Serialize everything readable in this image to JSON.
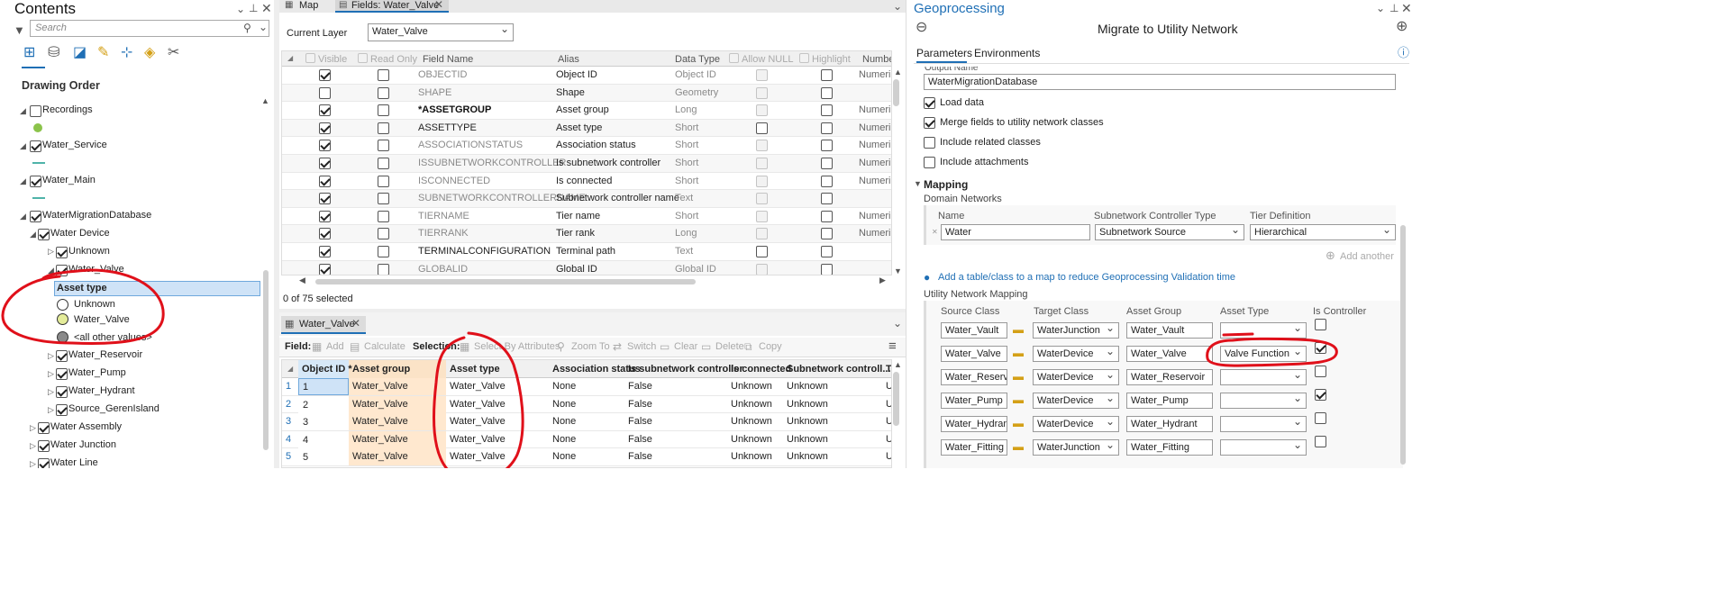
{
  "contents": {
    "title": "Contents",
    "search_placeholder": "Search",
    "section": "Drawing Order",
    "layers": [
      {
        "label": "Recordings"
      },
      {
        "label": "Water_Service"
      },
      {
        "label": "Water_Main"
      },
      {
        "label": "WaterMigrationDatabase"
      },
      {
        "label": "Water Device"
      },
      {
        "label": "Unknown"
      },
      {
        "label": "Water_Valve"
      },
      {
        "label": "Asset type"
      },
      {
        "label": "Unknown"
      },
      {
        "label": "Water_Valve"
      },
      {
        "label": "<all other values>"
      },
      {
        "label": "Water_Reservoir"
      },
      {
        "label": "Water_Pump"
      },
      {
        "label": "Water_Hydrant"
      },
      {
        "label": "Source_GerenIsland"
      },
      {
        "label": "Water Assembly"
      },
      {
        "label": "Water Junction"
      },
      {
        "label": "Water Line"
      }
    ]
  },
  "tabs": {
    "map": "Map",
    "fields": "Fields: Water_Valve",
    "table": "Water_Valve"
  },
  "fields_view": {
    "current_layer_label": "Current Layer",
    "current_layer_value": "Water_Valve",
    "columns": [
      "Visible",
      "Read Only",
      "Field Name",
      "Alias",
      "Data Type",
      "Allow NULL",
      "Highlight",
      "Number"
    ],
    "rows": [
      {
        "name": "OBJECTID",
        "alias": "Object ID",
        "type": "Object ID",
        "num": "Numeric",
        "visible": true,
        "readonly": false,
        "allownull": false,
        "highlight": false,
        "grayname": true,
        "graytype": true
      },
      {
        "name": "SHAPE",
        "alias": "Shape",
        "type": "Geometry",
        "num": "",
        "visible": false,
        "readonly": false,
        "allownull": false,
        "highlight": false,
        "grayname": true,
        "graytype": true
      },
      {
        "name": "*ASSETGROUP",
        "alias": "Asset group",
        "type": "Long",
        "num": "Numeric",
        "visible": true,
        "readonly": false,
        "allownull": false,
        "highlight": false,
        "bold": true
      },
      {
        "name": "ASSETTYPE",
        "alias": "Asset type",
        "type": "Short",
        "num": "Numeric",
        "visible": true,
        "readonly": false,
        "allownull": true,
        "highlight": false
      },
      {
        "name": "ASSOCIATIONSTATUS",
        "alias": "Association status",
        "type": "Short",
        "num": "Numeric",
        "visible": true,
        "readonly": false,
        "allownull": false,
        "highlight": false,
        "grayname": true,
        "graytype": true
      },
      {
        "name": "ISSUBNETWORKCONTROLLER",
        "alias": "Is subnetwork controller",
        "type": "Short",
        "num": "Numeric",
        "visible": true,
        "readonly": false,
        "allownull": false,
        "highlight": false,
        "grayname": true,
        "graytype": true
      },
      {
        "name": "ISCONNECTED",
        "alias": "Is connected",
        "type": "Short",
        "num": "Numeric",
        "visible": true,
        "readonly": false,
        "allownull": false,
        "highlight": false,
        "grayname": true,
        "graytype": true
      },
      {
        "name": "SUBNETWORKCONTROLLERNAME",
        "alias": "Subnetwork controller name",
        "type": "Text",
        "num": "",
        "visible": true,
        "readonly": false,
        "allownull": false,
        "highlight": false,
        "grayname": true,
        "graytype": true
      },
      {
        "name": "TIERNAME",
        "alias": "Tier name",
        "type": "Short",
        "num": "Numeric",
        "visible": true,
        "readonly": false,
        "allownull": false,
        "highlight": false,
        "grayname": true,
        "graytype": true
      },
      {
        "name": "TIERRANK",
        "alias": "Tier rank",
        "type": "Long",
        "num": "Numeric",
        "visible": true,
        "readonly": false,
        "allownull": false,
        "highlight": false,
        "grayname": true,
        "graytype": true
      },
      {
        "name": "TERMINALCONFIGURATION",
        "alias": "Terminal path",
        "type": "Text",
        "num": "",
        "visible": true,
        "readonly": false,
        "allownull": true,
        "highlight": false
      },
      {
        "name": "GLOBALID",
        "alias": "Global ID",
        "type": "Global ID",
        "num": "",
        "visible": true,
        "readonly": false,
        "allownull": false,
        "highlight": false,
        "grayname": true,
        "graytype": true
      }
    ],
    "status": "0 of 75 selected"
  },
  "table_view": {
    "toolbar": {
      "field": "Field:",
      "add": "Add",
      "calculate": "Calculate",
      "selection": "Selection:",
      "select_by": "Select By Attributes",
      "zoom_to": "Zoom To",
      "switch": "Switch",
      "clear": "Clear",
      "delete": "Delete",
      "copy": "Copy"
    },
    "columns": [
      "Object ID *",
      "Asset group",
      "Asset type",
      "Association status",
      "Is subnetwork controller",
      "Is connected",
      "Subnetwork controll...",
      "Ti"
    ],
    "rows": [
      [
        "1",
        "1",
        "Water_Valve",
        "Water_Valve",
        "None",
        "False",
        "Unknown",
        "Unknown",
        "U"
      ],
      [
        "2",
        "2",
        "Water_Valve",
        "Water_Valve",
        "None",
        "False",
        "Unknown",
        "Unknown",
        "U"
      ],
      [
        "3",
        "3",
        "Water_Valve",
        "Water_Valve",
        "None",
        "False",
        "Unknown",
        "Unknown",
        "U"
      ],
      [
        "4",
        "4",
        "Water_Valve",
        "Water_Valve",
        "None",
        "False",
        "Unknown",
        "Unknown",
        "U"
      ],
      [
        "5",
        "5",
        "Water_Valve",
        "Water_Valve",
        "None",
        "False",
        "Unknown",
        "Unknown",
        "U"
      ]
    ]
  },
  "geoprocessing": {
    "title": "Geoprocessing",
    "tool": "Migrate to Utility Network",
    "tab_parameters": "Parameters",
    "tab_environments": "Environments",
    "output_name_label": "Output Name",
    "output_name_value": "WaterMigrationDatabase",
    "load_data": "Load data",
    "merge_fields": "Merge fields to utility network classes",
    "include_related": "Include related classes",
    "include_attachments": "Include attachments",
    "mapping": "Mapping",
    "domain_networks": "Domain Networks",
    "dn_headers": [
      "Name",
      "Subnetwork Controller Type",
      "Tier Definition"
    ],
    "dn_row": [
      "Water",
      "Subnetwork Source",
      "Hierarchical"
    ],
    "add_another": "Add another",
    "info": "Add a table/class to a map to reduce Geoprocessing Validation time",
    "un_mapping": "Utility Network Mapping",
    "map_headers": [
      "Source Class",
      "Target Class",
      "Asset Group",
      "Asset Type",
      "Is Controller"
    ],
    "map_rows": [
      {
        "source": "Water_Vault",
        "target": "WaterJunction",
        "group": "Water_Vault",
        "type": "",
        "ctrl": false
      },
      {
        "source": "Water_Valve",
        "target": "WaterDevice",
        "group": "Water_Valve",
        "type": "Valve Function",
        "ctrl": true
      },
      {
        "source": "Water_Reservoir",
        "target": "WaterDevice",
        "group": "Water_Reservoir",
        "type": "",
        "ctrl": false
      },
      {
        "source": "Water_Pump",
        "target": "WaterDevice",
        "group": "Water_Pump",
        "type": "",
        "ctrl": true
      },
      {
        "source": "Water_Hydrant",
        "target": "WaterDevice",
        "group": "Water_Hydrant",
        "type": "",
        "ctrl": false
      },
      {
        "source": "Water_Fitting",
        "target": "WaterJunction",
        "group": "Water_Fitting",
        "type": "",
        "ctrl": false
      }
    ]
  },
  "colors": {
    "accent": "#1f6fb5",
    "annotation": "#e0101a",
    "selection": "#cfe3f7",
    "orange_col": "#fbe3c7",
    "highlight_cell": "#ffe8cf"
  }
}
